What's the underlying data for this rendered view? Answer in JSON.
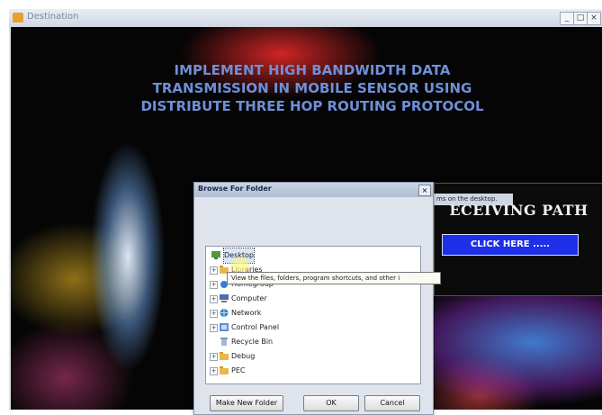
{
  "window": {
    "title": "Destination",
    "controls": [
      "_",
      "□",
      "×"
    ]
  },
  "heading": "IMPLEMENT HIGH BANDWIDTH DATA\nTRANSMISSION IN MOBILE SENSOR USING\nDISTRIBUTE THREE HOP ROUTING PROTOCOL",
  "right_panel": {
    "title": "ECEIVING PATH",
    "button": "CLICK HERE .....",
    "tip": "ms on the desktop."
  },
  "dialog": {
    "title": "Browse For Folder",
    "close": "×",
    "tooltip": "View the files, folders, program shortcuts, and other i",
    "tree": [
      {
        "label": "Desktop",
        "icon": "desktop-icon",
        "selected": true
      },
      {
        "label": "Libraries",
        "icon": "libraries-icon"
      },
      {
        "label": "Homegroup",
        "icon": "homegroup-icon"
      },
      {
        "label": "Computer",
        "icon": "computer-icon"
      },
      {
        "label": "Network",
        "icon": "network-icon"
      },
      {
        "label": "Control Panel",
        "icon": "control-panel-icon"
      },
      {
        "label": "Recycle Bin",
        "icon": "recycle-bin-icon"
      },
      {
        "label": "Debug",
        "icon": "folder-icon"
      },
      {
        "label": "PEC",
        "icon": "folder-icon"
      }
    ],
    "buttons": {
      "new_folder": "Make New Folder",
      "ok": "OK",
      "cancel": "Cancel"
    }
  },
  "colors": {
    "heading": "#6f8fd8",
    "click_button": "#1e2fe8",
    "folder": "#e8b84a"
  }
}
